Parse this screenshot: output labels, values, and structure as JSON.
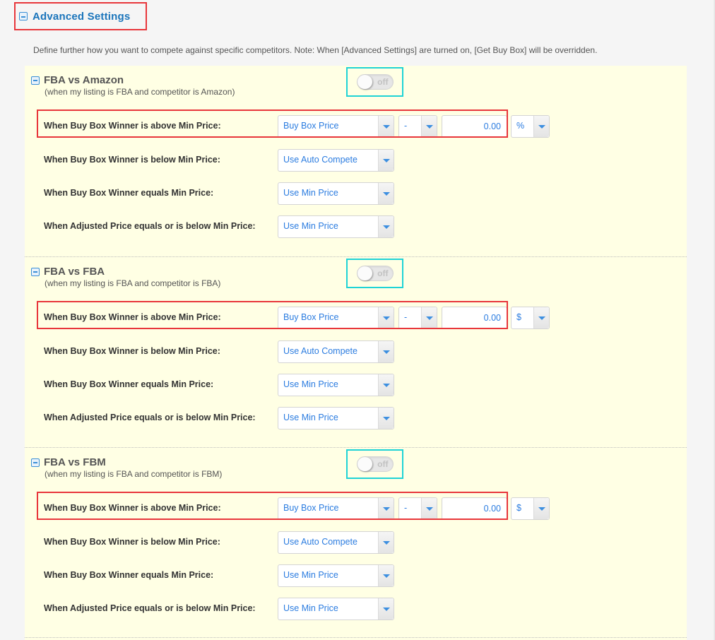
{
  "advanced": {
    "title": "Advanced Settings",
    "description": "Define further how you want to compete against specific competitors. Note: When [Advanced Settings] are turned on, [Get Buy Box] will be overridden."
  },
  "colors": {
    "accent": "#1b75bb",
    "highlight_red": "#e8363b",
    "highlight_cyan": "#1fd3d6",
    "panel_bg": "#ffffe4",
    "select_text": "#2b7ce0"
  },
  "sections": [
    {
      "title": "FBA vs Amazon",
      "subtitle": "(when my listing is FBA and competitor is Amazon)",
      "toggle": {
        "state": "off",
        "label": "off"
      },
      "rows": [
        {
          "label": "When Buy Box Winner is above Min Price:",
          "select": "Buy Box Price",
          "operator": "-",
          "amount": "0.00",
          "unit": "%"
        },
        {
          "label": "When Buy Box Winner is below Min Price:",
          "select": "Use Auto Compete"
        },
        {
          "label": "When Buy Box Winner equals Min Price:",
          "select": "Use Min Price"
        },
        {
          "label": "When Adjusted Price equals or is below Min Price:",
          "select": "Use Min Price"
        }
      ]
    },
    {
      "title": "FBA vs FBA",
      "subtitle": "(when my listing is FBA and competitor is FBA)",
      "toggle": {
        "state": "off",
        "label": "off"
      },
      "rows": [
        {
          "label": "When Buy Box Winner is above Min Price:",
          "select": "Buy Box Price",
          "operator": "-",
          "amount": "0.00",
          "unit": "$"
        },
        {
          "label": "When Buy Box Winner is below Min Price:",
          "select": "Use Auto Compete"
        },
        {
          "label": "When Buy Box Winner equals Min Price:",
          "select": "Use Min Price"
        },
        {
          "label": "When Adjusted Price equals or is below Min Price:",
          "select": "Use Min Price"
        }
      ]
    },
    {
      "title": "FBA vs FBM",
      "subtitle": "(when my listing is FBA and competitor is FBM)",
      "toggle": {
        "state": "off",
        "label": "off"
      },
      "rows": [
        {
          "label": "When Buy Box Winner is above Min Price:",
          "select": "Buy Box Price",
          "operator": "-",
          "amount": "0.00",
          "unit": "$"
        },
        {
          "label": "When Buy Box Winner is below Min Price:",
          "select": "Use Auto Compete"
        },
        {
          "label": "When Buy Box Winner equals Min Price:",
          "select": "Use Min Price"
        },
        {
          "label": "When Adjusted Price equals or is below Min Price:",
          "select": "Use Min Price"
        }
      ]
    }
  ]
}
